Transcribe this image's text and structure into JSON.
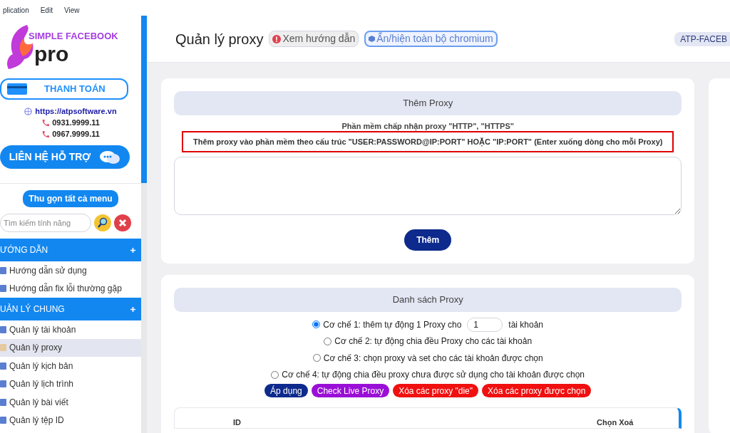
{
  "menu_bar": [
    "plication",
    "Edit",
    "View"
  ],
  "sidebar": {
    "logo": {
      "line1": "SIMPLE FACEBOOK",
      "line2": "pro"
    },
    "pay_button": "THANH TOÁN",
    "website": "https://atpsoftware.vn",
    "phones": [
      "0931.9999.11",
      "0967.9999.11"
    ],
    "support_button": "LIÊN HỆ HỖ TRỢ",
    "collapse_button": "Thu gọn tất cả menu",
    "search": {
      "placeholder": "Tìm kiếm tính năng"
    },
    "sections": [
      {
        "title": "ƯỚNG DẪN",
        "items": [
          {
            "label": "Hướng dẫn sử dụng",
            "selected": false
          },
          {
            "label": "Hướng dẫn fix lỗi thường gặp",
            "selected": false
          }
        ]
      },
      {
        "title": "UẢN LÝ CHUNG",
        "items": [
          {
            "label": "Quản lý tài khoản",
            "selected": false
          },
          {
            "label": "Quản lý proxy",
            "selected": true
          },
          {
            "label": "Quản lý kịch bản",
            "selected": false
          },
          {
            "label": "Quản lý lịch trình",
            "selected": false
          },
          {
            "label": "Quản lý bài viết",
            "selected": false
          },
          {
            "label": "Quản lý tệp ID",
            "selected": false
          }
        ]
      }
    ]
  },
  "header": {
    "title": "Quản lý proxy",
    "guide_button": "Xem hướng dẫn",
    "chromium_button": "Ẩn/hiện toàn bộ chromium",
    "profile_badge": "ATP-FACEB"
  },
  "add_proxy": {
    "title": "Thêm Proxy",
    "note": "Phần mềm chấp nhận proxy \"HTTP\", \"HTTPS\"",
    "instruction": "Thêm proxy vào phần mềm theo cấu trúc \"USER:PASSWORD@IP:PORT\" HOẶC \"IP:PORT\" (Enter xuống dòng cho mỗi Proxy)",
    "add_button": "Thêm"
  },
  "proxy_list": {
    "title": "Danh sách Proxy",
    "options": [
      {
        "kind": "count",
        "label": "Cơ chế 1: thêm tự động 1 Proxy cho",
        "value": "1",
        "suffix": "tài khoản",
        "selected": true
      },
      {
        "kind": "plain",
        "label": "Cơ chế 2: tự động chia đều Proxy cho các tài khoản",
        "selected": false
      },
      {
        "kind": "plain",
        "label": "Cơ chế 3: chọn proxy và set cho các tài khoản được chọn",
        "selected": false
      },
      {
        "kind": "plain",
        "label": "Cơ chế 4: tự động chia đều proxy chưa được sử dụng cho tài khoản được chọn",
        "selected": false
      }
    ],
    "buttons": [
      {
        "label": "Áp dụng",
        "color": "#0d2a8c"
      },
      {
        "label": "Check Live Proxy",
        "color": "#9a0fd6"
      },
      {
        "label": "Xóa các proxy \"die\"",
        "color": "#f01010"
      },
      {
        "label": "Xóa các proxy được chọn",
        "color": "#f01010"
      }
    ],
    "table": {
      "columns": [
        "ID",
        "Chọn Xoá"
      ]
    }
  }
}
